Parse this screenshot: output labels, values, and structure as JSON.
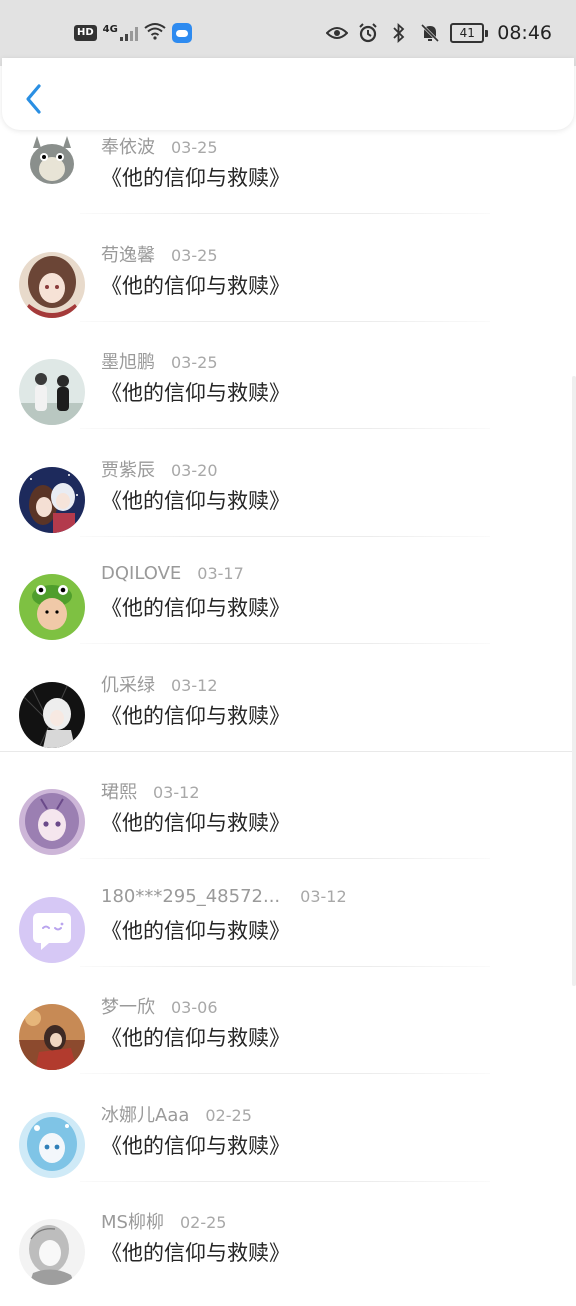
{
  "status_bar": {
    "time": "08:46",
    "battery": "41",
    "network_badge": "HD",
    "network_type": "4G"
  },
  "header": {
    "back_icon": "chevron-left-icon"
  },
  "colors": {
    "accent": "#2a8fe3",
    "status_bar_bg": "#e2e2e2",
    "title_text": "#262626",
    "meta_text": "#9a9a9a"
  },
  "list": [
    {
      "name": "奉依波",
      "date": "03-25",
      "title": "《他的信仰与救赎》"
    },
    {
      "name": "苟逸馨",
      "date": "03-25",
      "title": "《他的信仰与救赎》"
    },
    {
      "name": "墨旭鹏",
      "date": "03-25",
      "title": "《他的信仰与救赎》"
    },
    {
      "name": "贾紫辰",
      "date": "03-20",
      "title": "《他的信仰与救赎》"
    },
    {
      "name": "DQILOVE",
      "date": "03-17",
      "title": "《他的信仰与救赎》"
    },
    {
      "name": "仉采绿",
      "date": "03-12",
      "title": "《他的信仰与救赎》"
    },
    {
      "name": "珺熙",
      "date": "03-12",
      "title": "《他的信仰与救赎》"
    },
    {
      "name": "180***295_48572...",
      "date": "03-12",
      "title": "《他的信仰与救赎》"
    },
    {
      "name": "梦一欣",
      "date": "03-06",
      "title": "《他的信仰与救赎》"
    },
    {
      "name": "冰娜儿Aaa",
      "date": "02-25",
      "title": "《他的信仰与救赎》"
    },
    {
      "name": "MS柳柳",
      "date": "02-25",
      "title": "《他的信仰与救赎》"
    }
  ]
}
